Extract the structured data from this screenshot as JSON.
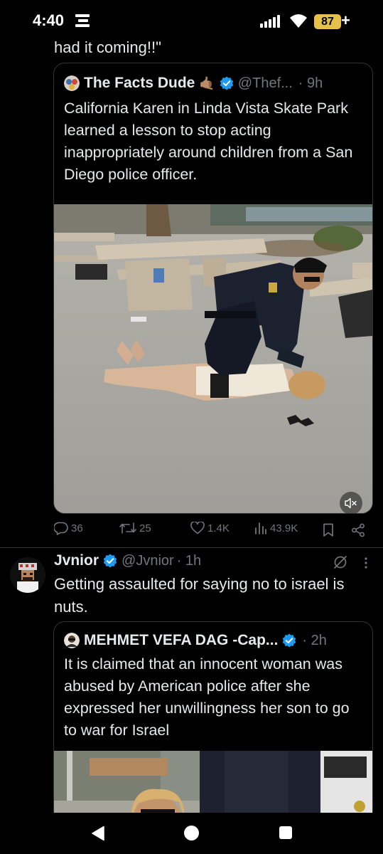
{
  "status_bar": {
    "time": "4:40",
    "battery": "87",
    "battery_suffix": "+"
  },
  "prev_tweet_tail": "had it coming!!\"",
  "quote1": {
    "name": "The Facts Dude",
    "emoji": "🤙🏽",
    "handle": "@Thef...",
    "time": "· 9h",
    "text": "California Karen in Linda Vista Skate Park learned a lesson to stop acting inappropriately around children from a San Diego police officer.",
    "mute_icon": "speaker-muted-icon"
  },
  "actions": {
    "replies": "36",
    "reposts": "25",
    "likes": "1.4K",
    "views": "43.9K"
  },
  "tweet2": {
    "name": "Jvnior",
    "handle": "@Jvnior",
    "time": "· 1h",
    "text": "Getting assaulted for saying no to israel is nuts."
  },
  "quote2": {
    "name": "MEHMET VEFA DAG -Cap...",
    "time": "· 2h",
    "text": "It is claimed that an innocent woman was abused by American police after she expressed her unwillingness her son  to go to war for Israel"
  },
  "colors": {
    "background": "#000000",
    "text": "#e7e9ea",
    "secondary": "#71767b",
    "verified": "#1d9bf0",
    "battery": "#e5c04a",
    "border": "#2f3336"
  }
}
